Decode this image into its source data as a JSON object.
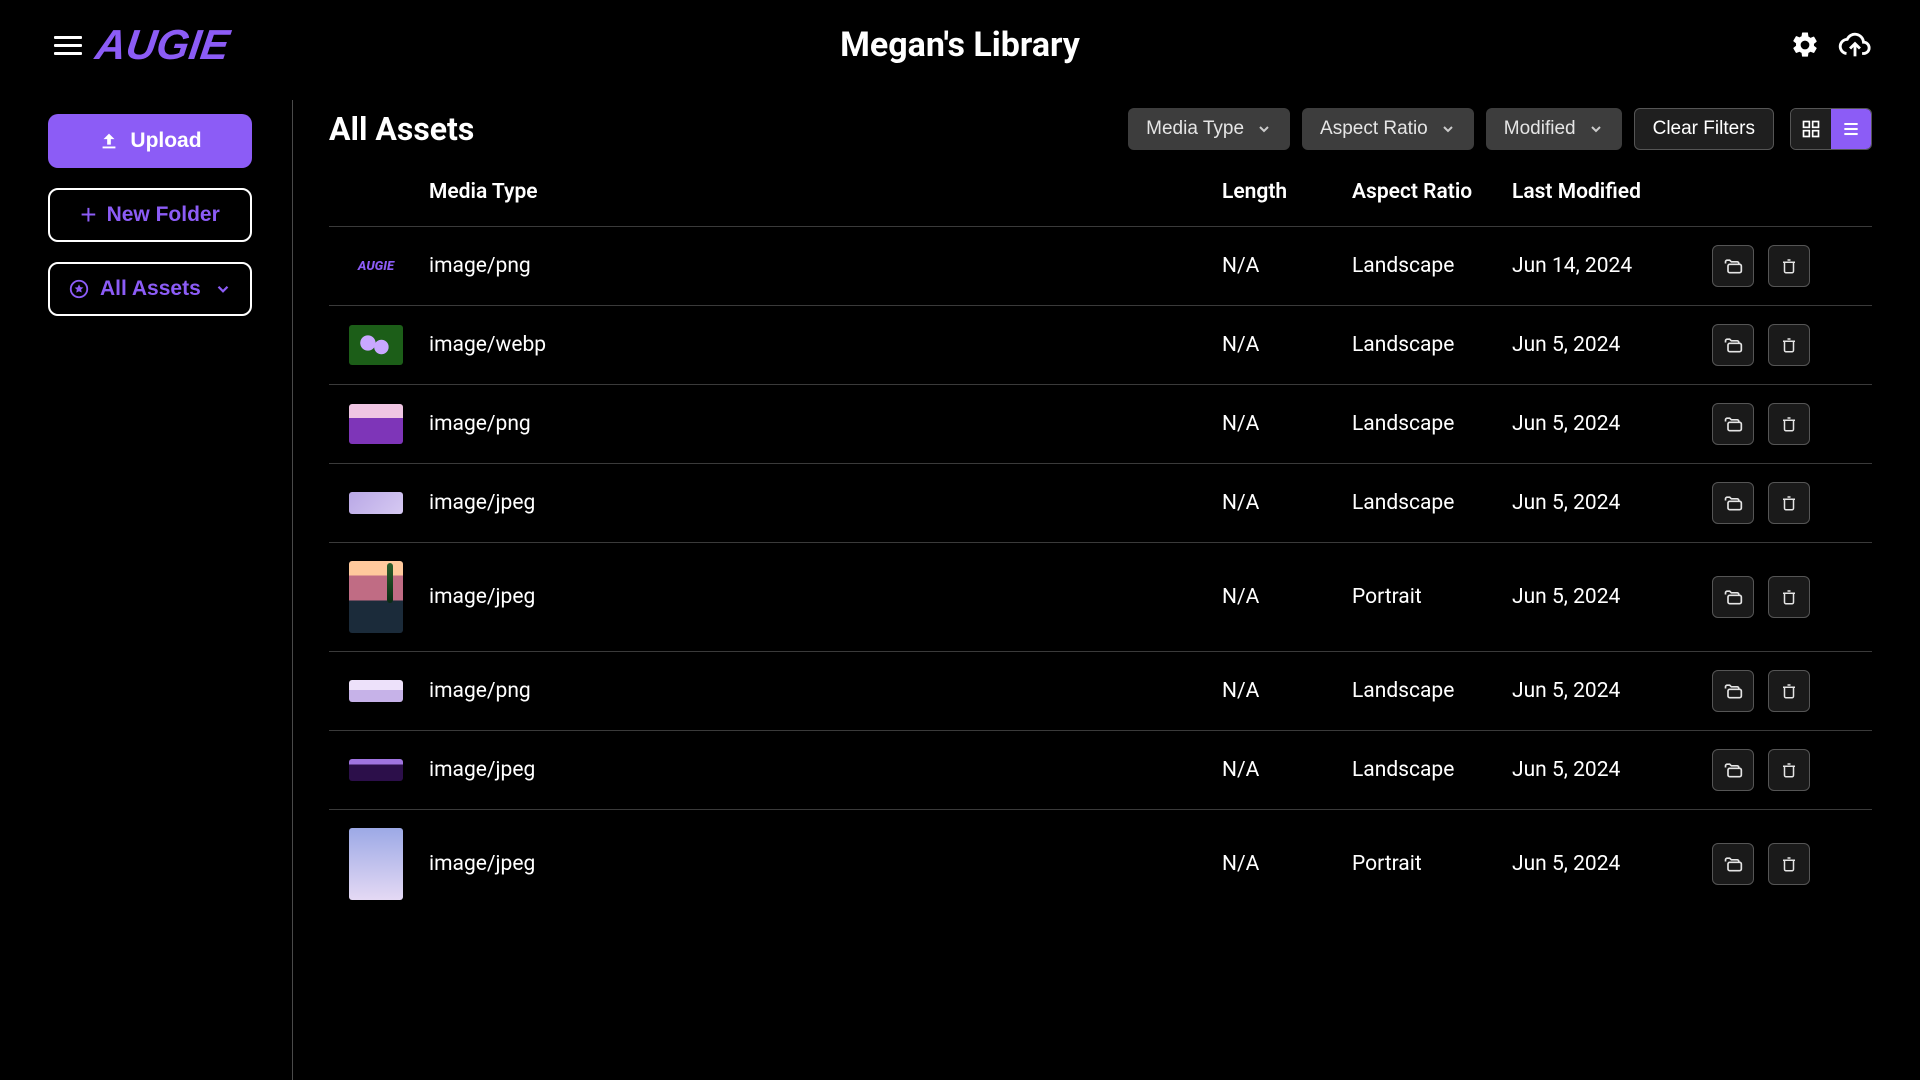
{
  "header": {
    "logo_text": "AUGIE",
    "title": "Megan's Library"
  },
  "sidebar": {
    "upload_label": "Upload",
    "new_folder_label": "New Folder",
    "all_assets_label": "All Assets"
  },
  "main": {
    "heading": "All Assets",
    "filters": {
      "media_type_label": "Media Type",
      "aspect_ratio_label": "Aspect Ratio",
      "modified_label": "Modified",
      "clear_label": "Clear Filters"
    },
    "columns": {
      "media_type": "Media Type",
      "length": "Length",
      "aspect_ratio": "Aspect Ratio",
      "last_modified": "Last Modified"
    },
    "rows": [
      {
        "media_type": "image/png",
        "length": "N/A",
        "aspect_ratio": "Landscape",
        "last_modified": "Jun 14, 2024",
        "thumb": "logo",
        "shape": "wide"
      },
      {
        "media_type": "image/webp",
        "length": "N/A",
        "aspect_ratio": "Landscape",
        "last_modified": "Jun 5, 2024",
        "thumb": "flower",
        "shape": "wide"
      },
      {
        "media_type": "image/png",
        "length": "N/A",
        "aspect_ratio": "Landscape",
        "last_modified": "Jun 5, 2024",
        "thumb": "lavender",
        "shape": "wide"
      },
      {
        "media_type": "image/jpeg",
        "length": "N/A",
        "aspect_ratio": "Landscape",
        "last_modified": "Jun 5, 2024",
        "thumb": "pebbles",
        "shape": "short"
      },
      {
        "media_type": "image/jpeg",
        "length": "N/A",
        "aspect_ratio": "Portrait",
        "last_modified": "Jun 5, 2024",
        "thumb": "sunset",
        "shape": "tall"
      },
      {
        "media_type": "image/png",
        "length": "N/A",
        "aspect_ratio": "Landscape",
        "last_modified": "Jun 5, 2024",
        "thumb": "clouds",
        "shape": "short"
      },
      {
        "media_type": "image/jpeg",
        "length": "N/A",
        "aspect_ratio": "Landscape",
        "last_modified": "Jun 5, 2024",
        "thumb": "hills",
        "shape": "short"
      },
      {
        "media_type": "image/jpeg",
        "length": "N/A",
        "aspect_ratio": "Portrait",
        "last_modified": "Jun 5, 2024",
        "thumb": "sky",
        "shape": "tall"
      }
    ]
  }
}
